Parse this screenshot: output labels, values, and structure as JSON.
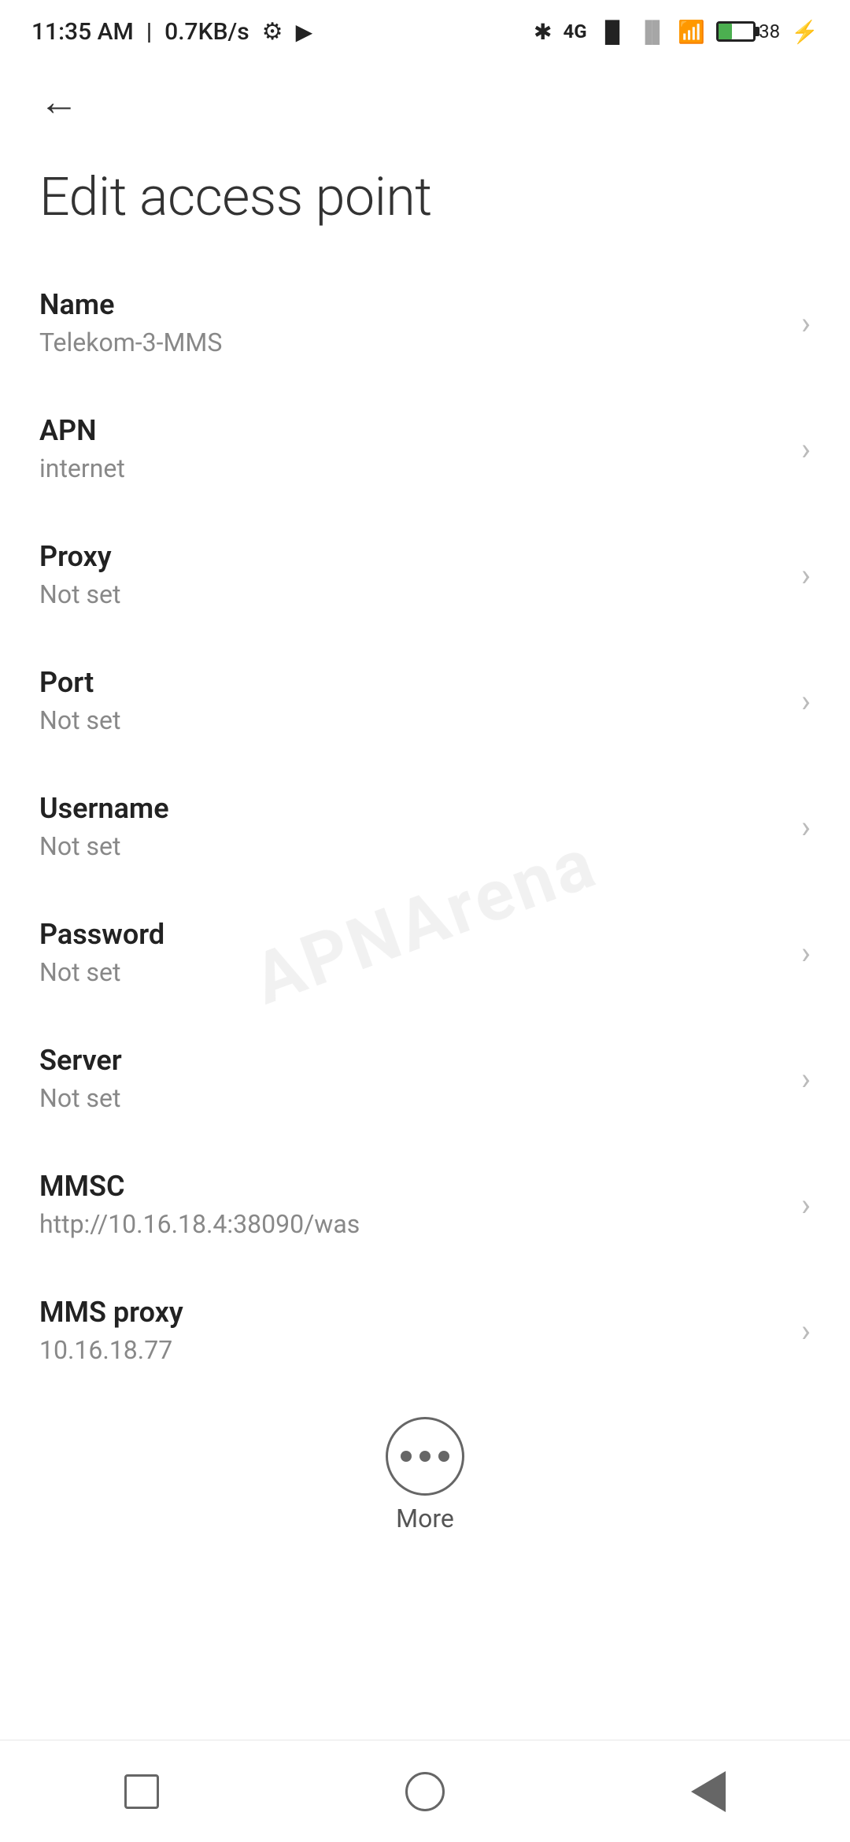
{
  "status_bar": {
    "time": "11:35 AM",
    "speed": "0.7KB/s"
  },
  "page": {
    "title": "Edit access point",
    "back_label": "back"
  },
  "settings": [
    {
      "label": "Name",
      "value": "Telekom-3-MMS"
    },
    {
      "label": "APN",
      "value": "internet"
    },
    {
      "label": "Proxy",
      "value": "Not set"
    },
    {
      "label": "Port",
      "value": "Not set"
    },
    {
      "label": "Username",
      "value": "Not set"
    },
    {
      "label": "Password",
      "value": "Not set"
    },
    {
      "label": "Server",
      "value": "Not set"
    },
    {
      "label": "MMSC",
      "value": "http://10.16.18.4:38090/was"
    },
    {
      "label": "MMS proxy",
      "value": "10.16.18.77"
    }
  ],
  "more": {
    "label": "More"
  },
  "watermark": "APNArena"
}
